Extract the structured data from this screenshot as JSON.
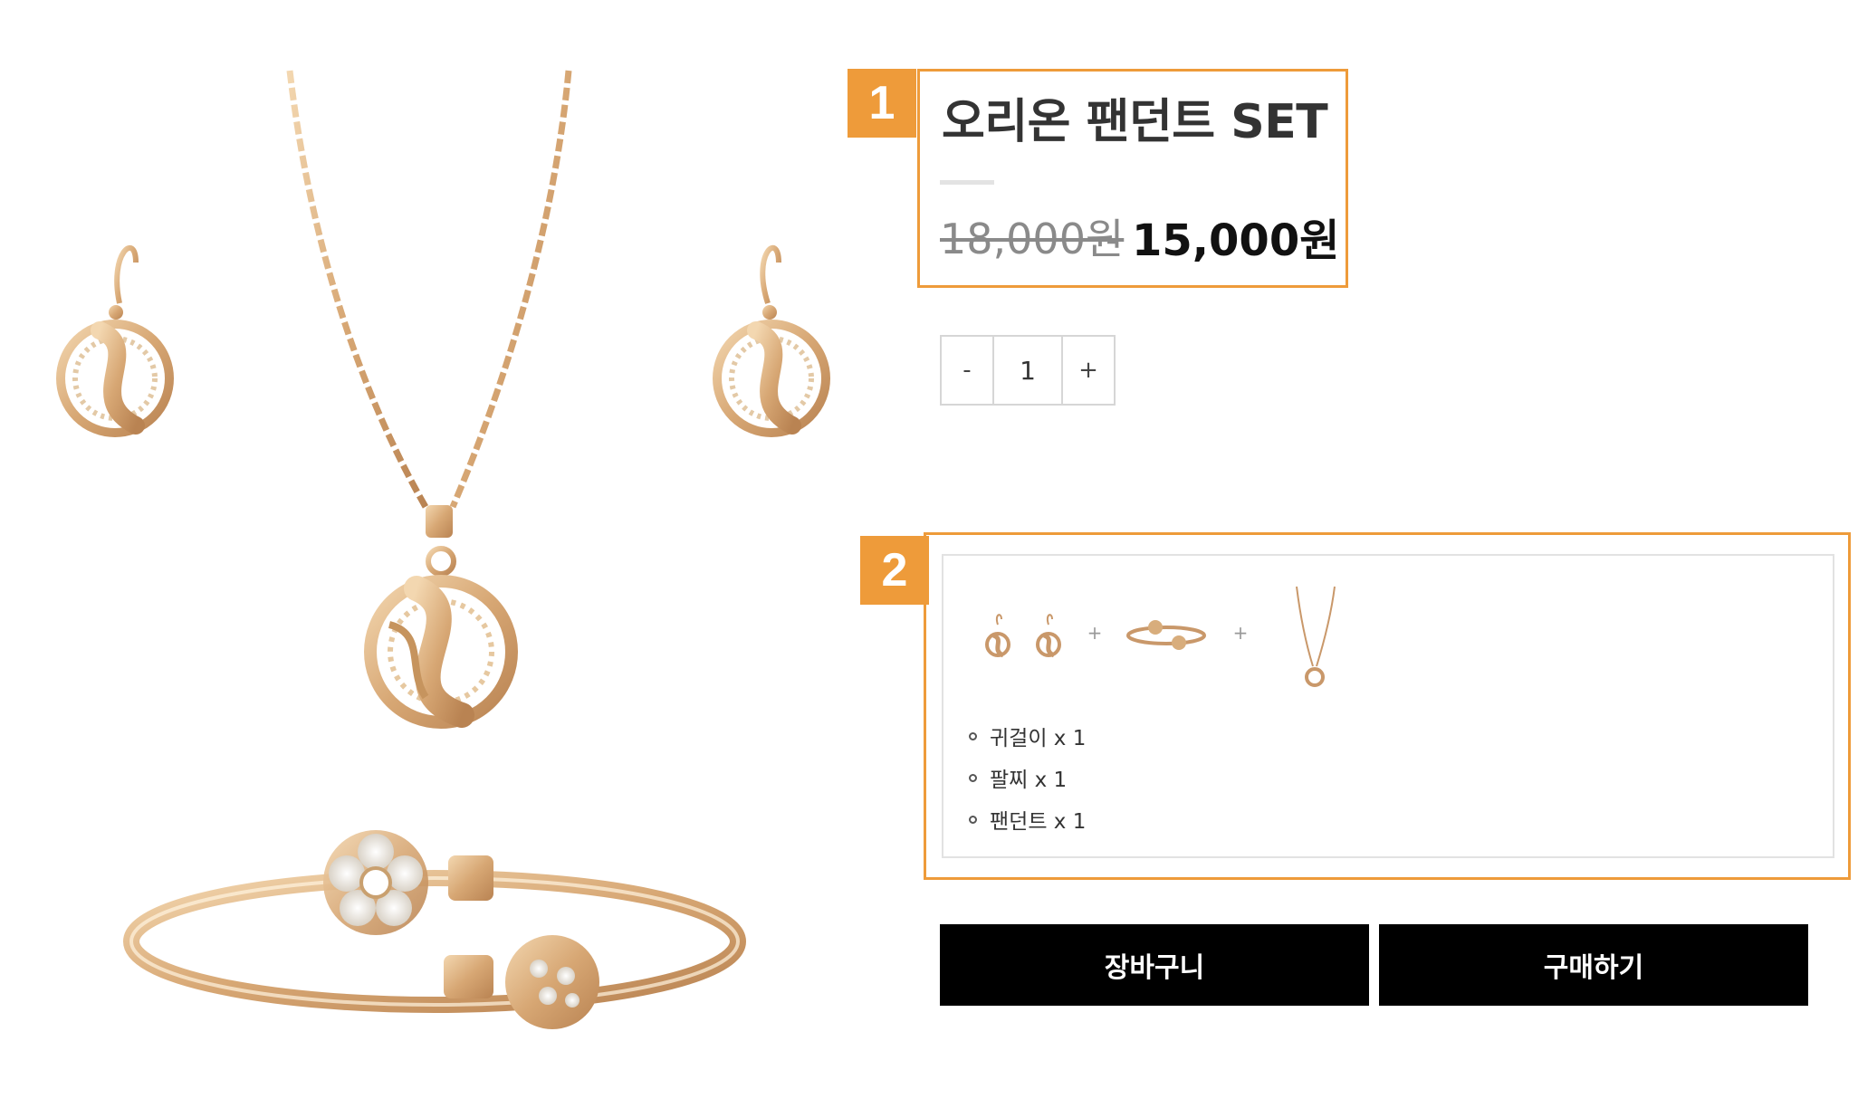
{
  "markers": {
    "first": "1",
    "second": "2"
  },
  "product": {
    "title": "오리온 팬던트 SET",
    "original_price": "18,000원",
    "sale_price": "15,000원"
  },
  "quantity": {
    "decrease": "-",
    "value": "1",
    "increase": "+"
  },
  "set": {
    "plus": "+",
    "items": [
      {
        "label": "귀걸이 x 1"
      },
      {
        "label": "팔찌 x 1"
      },
      {
        "label": "팬던트 x 1"
      }
    ]
  },
  "actions": {
    "cart_label": "장바구니",
    "buy_label": "구매하기"
  },
  "colors": {
    "accent": "#ee9b3a",
    "button": "#000000",
    "gold": "#d8ad7c"
  }
}
